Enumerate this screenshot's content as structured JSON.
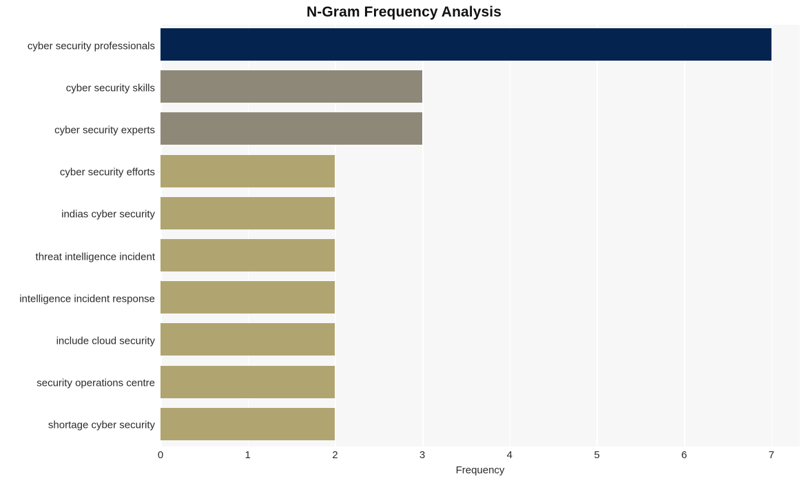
{
  "chart_data": {
    "type": "bar",
    "orientation": "horizontal",
    "title": "N-Gram Frequency Analysis",
    "xlabel": "Frequency",
    "ylabel": "",
    "xlim": [
      0,
      7.3245
    ],
    "xticks": [
      0,
      1,
      2,
      3,
      4,
      5,
      6,
      7
    ],
    "xtick_labels": [
      "0",
      "1",
      "2",
      "3",
      "4",
      "5",
      "6",
      "7"
    ],
    "grid": true,
    "grid_axis": "x",
    "legend": false,
    "categories": [
      "cyber security professionals",
      "cyber security skills",
      "cyber security experts",
      "cyber security efforts",
      "indias cyber security",
      "threat intelligence incident",
      "intelligence incident response",
      "include cloud security",
      "security operations centre",
      "shortage cyber security"
    ],
    "values": [
      7,
      3,
      3,
      2,
      2,
      2,
      2,
      2,
      2,
      2
    ],
    "bar_colors": [
      "#04244f",
      "#8e8878",
      "#8e8878",
      "#b0a571",
      "#b0a571",
      "#b0a571",
      "#b0a571",
      "#b0a571",
      "#b0a571",
      "#b0a571"
    ]
  },
  "style": {
    "plot_background": "#f7f7f7",
    "figure_background": "#ffffff",
    "gridline_color": "#ffffff",
    "title_color": "#111111",
    "tick_label_color": "#2b2b2b"
  }
}
